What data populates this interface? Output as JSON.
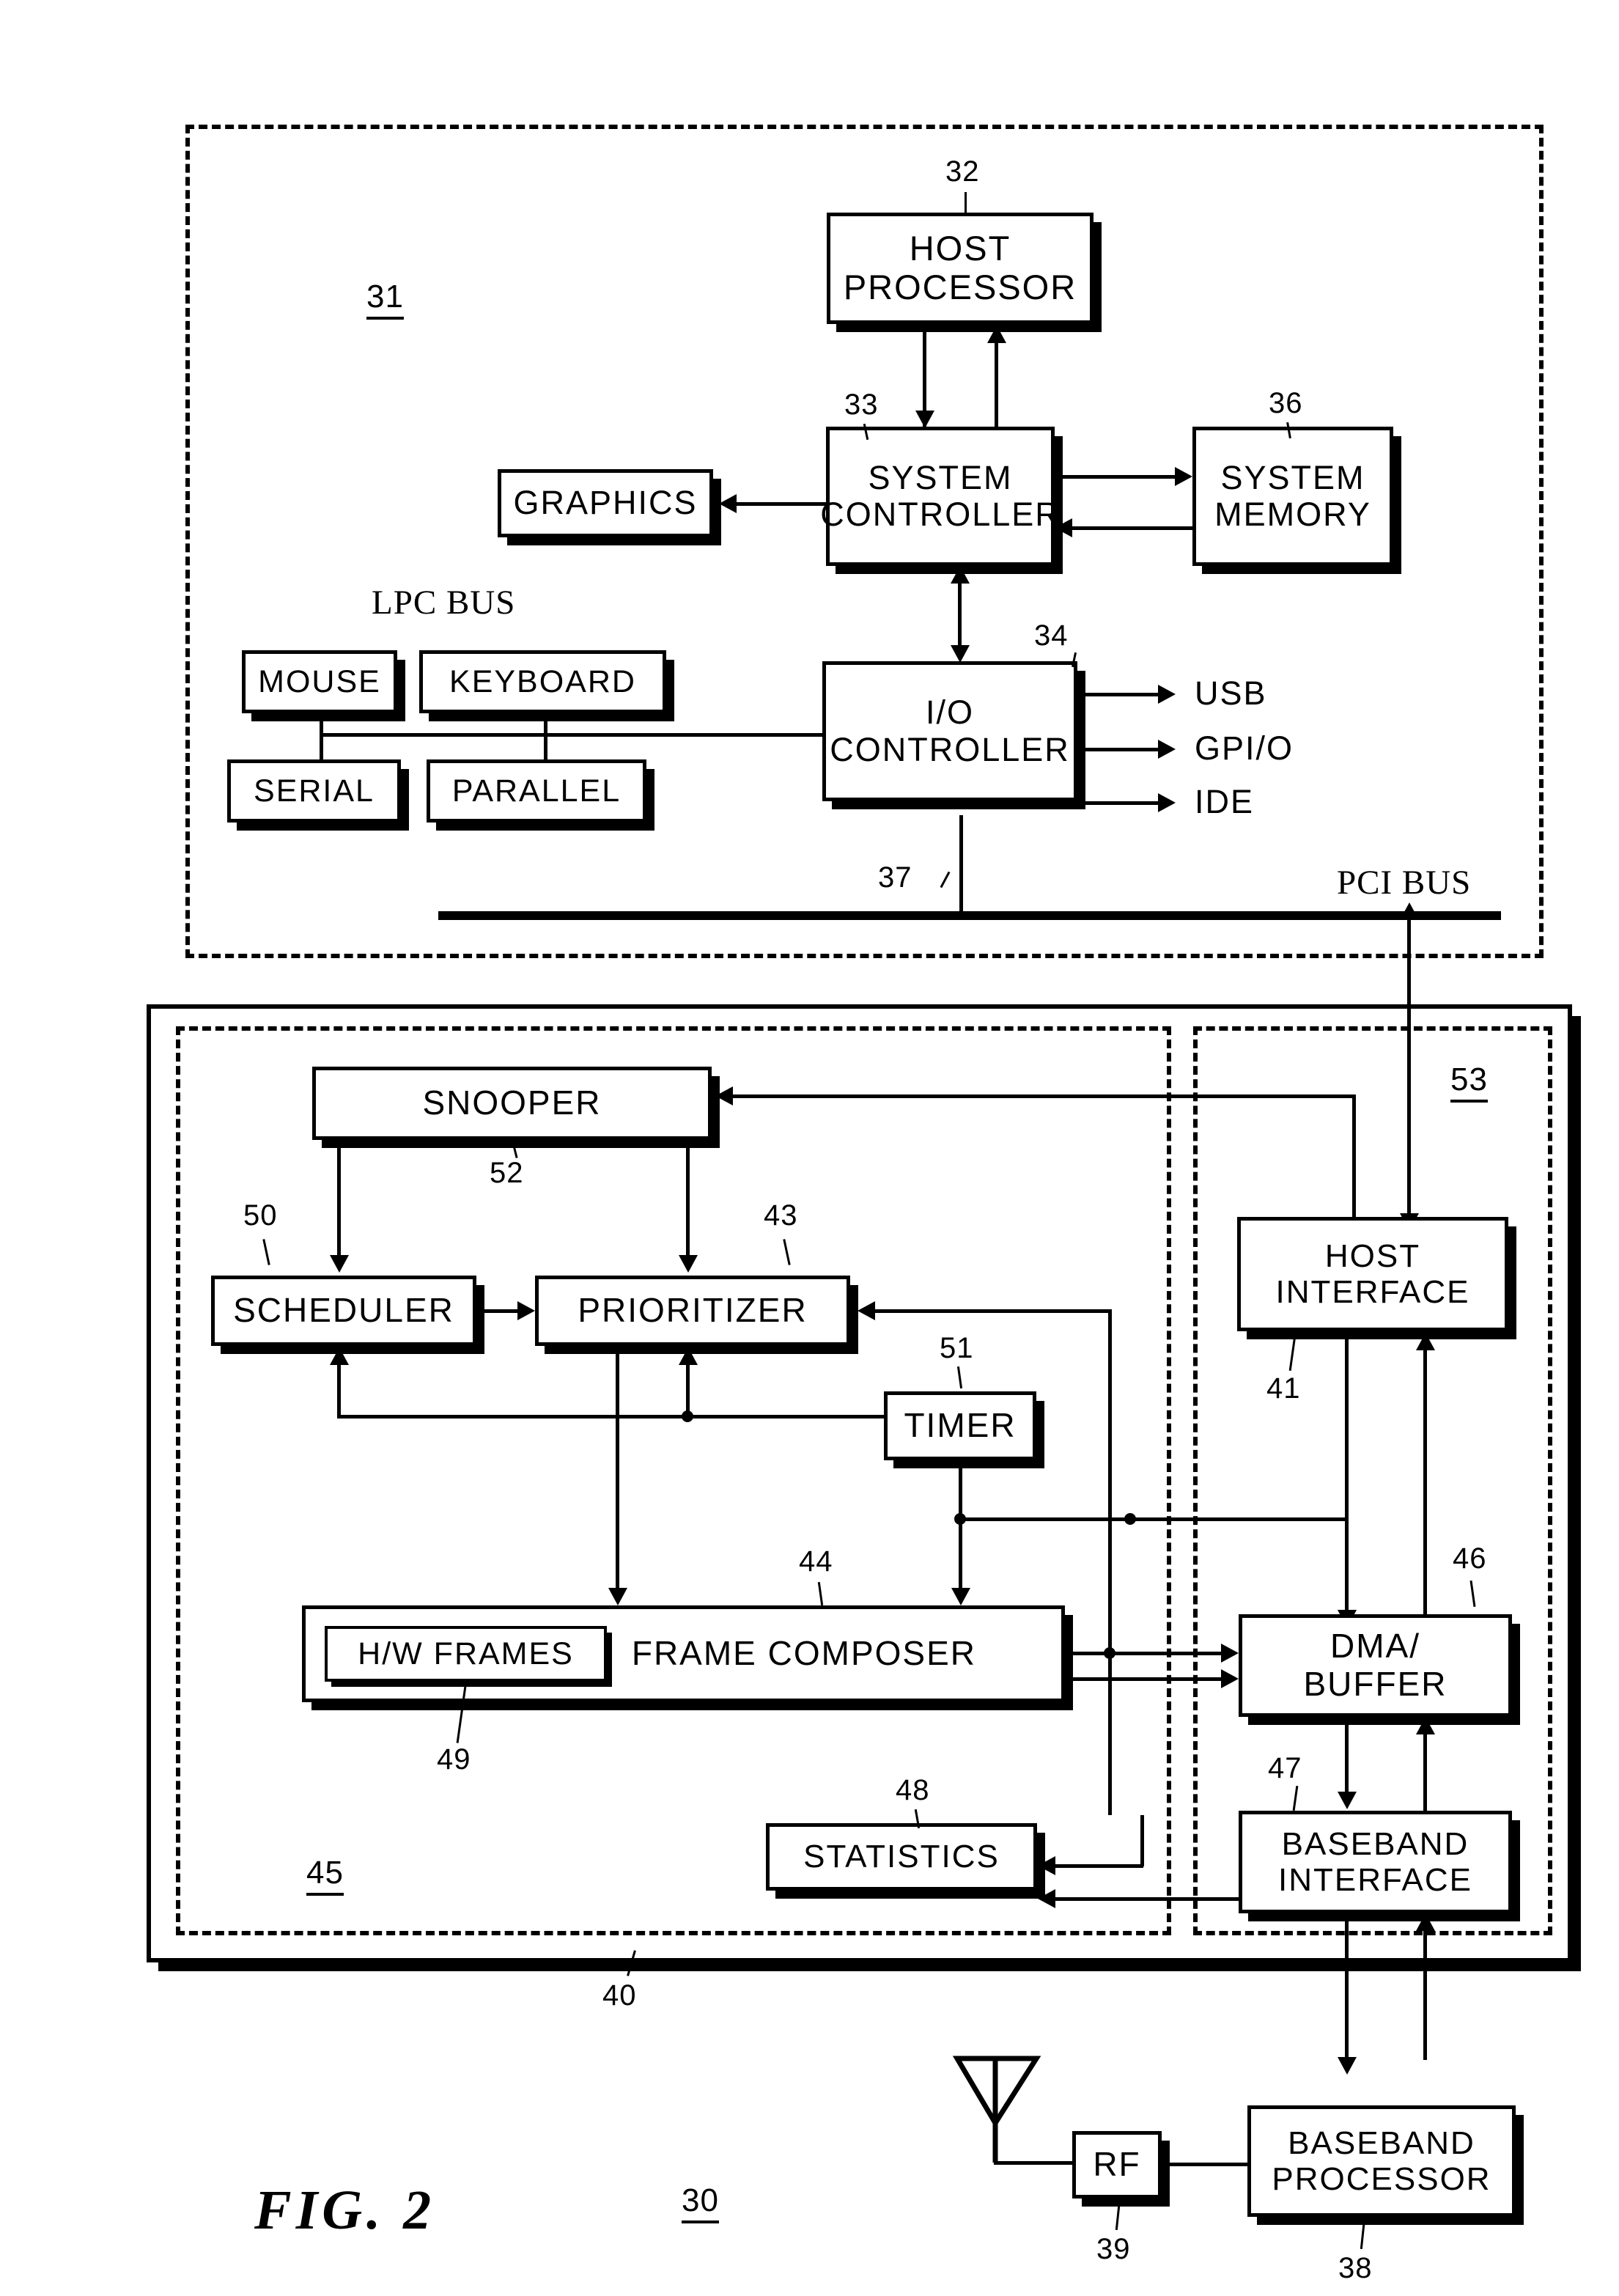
{
  "figure": {
    "caption": "FIG. 2",
    "system_ref": "30"
  },
  "host_section": {
    "ref": "31",
    "bus_label_lpc": "LPC BUS",
    "bus_label_pci": "PCI BUS",
    "pci_bus_ref": "37",
    "blocks": [
      {
        "id": "host_processor",
        "label_line1": "HOST",
        "label_line2": "PROCESSOR",
        "ref": "32"
      },
      {
        "id": "system_controller",
        "label_line1": "SYSTEM",
        "label_line2": "CONTROLLER",
        "ref": "33"
      },
      {
        "id": "system_memory",
        "label_line1": "SYSTEM",
        "label_line2": "MEMORY",
        "ref": "36"
      },
      {
        "id": "graphics",
        "label_line1": "GRAPHICS",
        "label_line2": "",
        "ref": ""
      },
      {
        "id": "io_controller",
        "label_line1": "I/O",
        "label_line2": "CONTROLLER",
        "ref": "34"
      },
      {
        "id": "mouse",
        "label_line1": "MOUSE",
        "label_line2": "",
        "ref": ""
      },
      {
        "id": "keyboard",
        "label_line1": "KEYBOARD",
        "label_line2": "",
        "ref": ""
      },
      {
        "id": "serial",
        "label_line1": "SERIAL",
        "label_line2": "",
        "ref": ""
      },
      {
        "id": "parallel",
        "label_line1": "PARALLEL",
        "label_line2": "",
        "ref": ""
      }
    ],
    "io_outputs": [
      "USB",
      "GPI/O",
      "IDE"
    ]
  },
  "adapter_section": {
    "outer_ref": "40",
    "mac_ref": "45",
    "host_side_ref": "53",
    "blocks": [
      {
        "id": "snooper",
        "label_line1": "SNOOPER",
        "label_line2": "",
        "ref": "52"
      },
      {
        "id": "scheduler",
        "label_line1": "SCHEDULER",
        "label_line2": "",
        "ref": "50"
      },
      {
        "id": "prioritizer",
        "label_line1": "PRIORITIZER",
        "label_line2": "",
        "ref": "43"
      },
      {
        "id": "timer",
        "label_line1": "TIMER",
        "label_line2": "",
        "ref": "51"
      },
      {
        "id": "frame_composer",
        "label_line1": "FRAME  COMPOSER",
        "label_line2": "",
        "ref": "44"
      },
      {
        "id": "hw_frames",
        "label_line1": "H/W FRAMES",
        "label_line2": "",
        "ref": "49"
      },
      {
        "id": "statistics",
        "label_line1": "STATISTICS",
        "label_line2": "",
        "ref": "48"
      },
      {
        "id": "host_interface",
        "label_line1": "HOST",
        "label_line2": "INTERFACE",
        "ref": "41"
      },
      {
        "id": "dma_buffer",
        "label_line1": "DMA/",
        "label_line2": "BUFFER",
        "ref": "46"
      },
      {
        "id": "baseband_interface",
        "label_line1": "BASEBAND",
        "label_line2": "INTERFACE",
        "ref": "47"
      }
    ]
  },
  "radio_section": {
    "blocks": [
      {
        "id": "rf",
        "label_line1": "RF",
        "label_line2": "",
        "ref": "39"
      },
      {
        "id": "baseband_processor",
        "label_line1": "BASEBAND",
        "label_line2": "PROCESSOR",
        "ref": "38"
      }
    ],
    "antenna_icon": "antenna-icon"
  }
}
